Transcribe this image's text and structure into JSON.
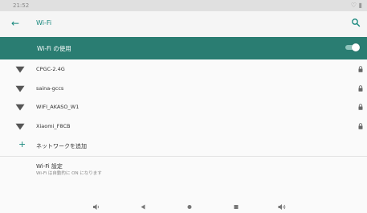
{
  "status_bar": {
    "time": "21:52",
    "system_icons": "♡ ▮"
  },
  "toolbar": {
    "back_icon": "arrow-left-icon",
    "title": "Wi-Fi",
    "search_icon": "search-icon"
  },
  "wifi_master": {
    "label": "Wi-Fi の使用",
    "enabled": true
  },
  "networks": [
    {
      "ssid": "CPGC-2.4G",
      "secured": true
    },
    {
      "ssid": "saina-gccs",
      "secured": true
    },
    {
      "ssid": "WIFI_AKASO_W1",
      "secured": true
    },
    {
      "ssid": "Xiaomi_F8CB",
      "secured": true
    }
  ],
  "add_network": {
    "label": "ネットワークを追加"
  },
  "wifi_settings": {
    "title": "Wi-Fi 設定",
    "subtitle": "Wi-Fi は自動的に ON になります"
  },
  "nav_bar": [
    "volume-down-icon",
    "back-triangle-icon",
    "home-circle-icon",
    "recents-square-icon",
    "volume-up-icon"
  ],
  "colors": {
    "accent": "#16877c",
    "header_bar": "#2a7d72",
    "background": "#fafafa"
  }
}
